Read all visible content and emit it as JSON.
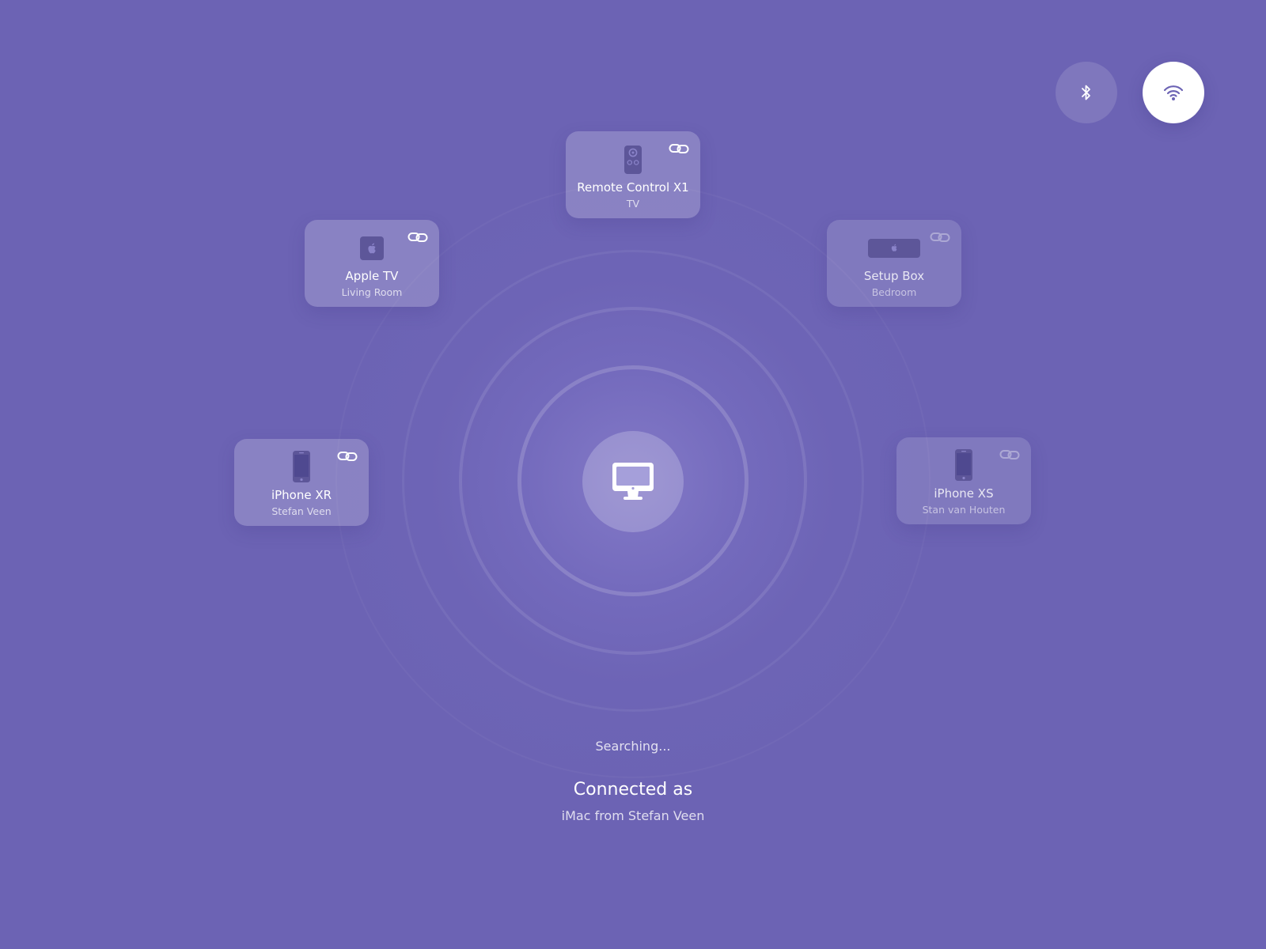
{
  "colors": {
    "background": "#6c63b4",
    "icon_dark": "#5d5699",
    "white": "#ffffff"
  },
  "top_controls": {
    "bluetooth": {
      "icon": "bluetooth-icon",
      "active": false
    },
    "wifi": {
      "icon": "wifi-icon",
      "active": true
    }
  },
  "center_device": {
    "icon": "desktop-monitor-icon"
  },
  "devices": [
    {
      "name": "Remote Control X1",
      "subtitle": "TV",
      "icon": "remote-control-icon",
      "linked": true
    },
    {
      "name": "Apple TV",
      "subtitle": "Living Room",
      "icon": "apple-tv-icon",
      "linked": true
    },
    {
      "name": "Setup Box",
      "subtitle": "Bedroom",
      "icon": "setup-box-icon",
      "linked": false
    },
    {
      "name": "iPhone XR",
      "subtitle": "Stefan Veen",
      "icon": "phone-icon",
      "linked": true
    },
    {
      "name": "iPhone XS",
      "subtitle": "Stan van Houten",
      "icon": "phone-icon",
      "linked": false
    }
  ],
  "status": {
    "searching": "Searching...",
    "connected_title": "Connected as",
    "connected_name": "iMac from Stefan Veen"
  }
}
